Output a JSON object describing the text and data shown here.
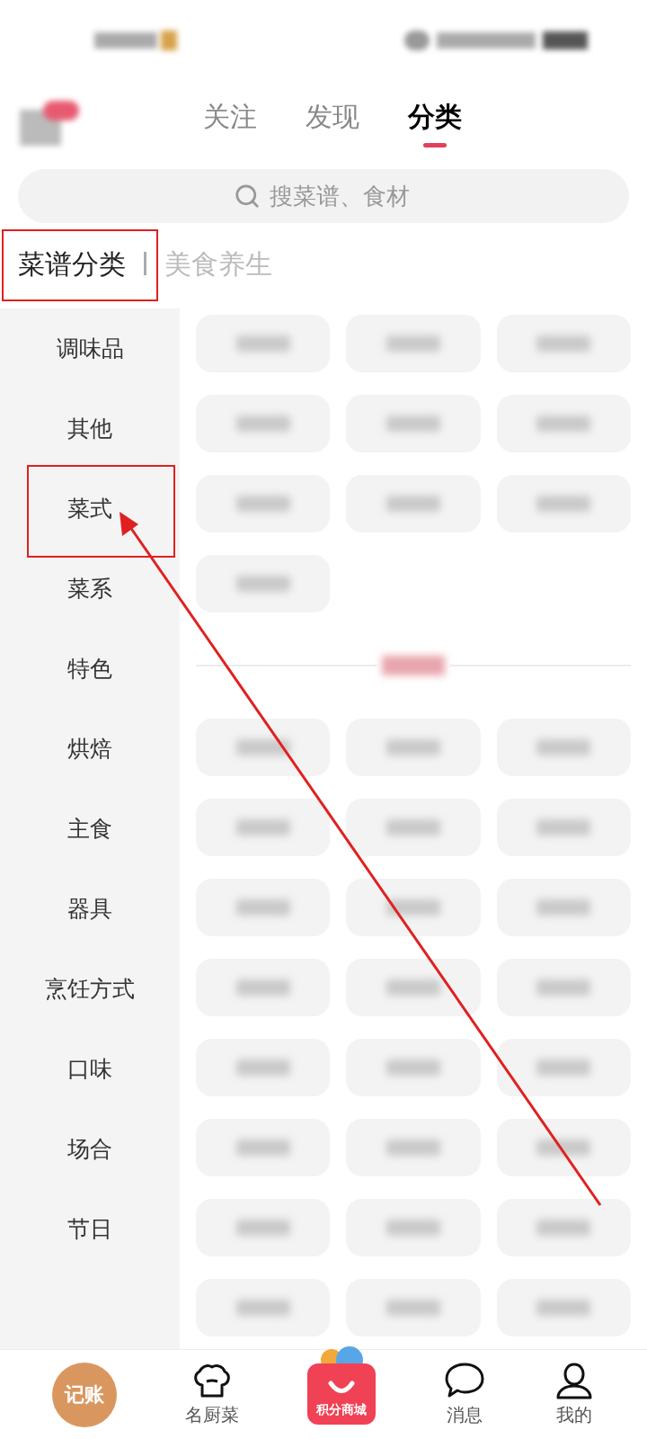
{
  "top_tabs": [
    {
      "label": "关注",
      "selected": false
    },
    {
      "label": "发现",
      "selected": false
    },
    {
      "label": "分类",
      "selected": true
    }
  ],
  "search": {
    "placeholder": "搜菜谱、食材"
  },
  "sub_tabs": [
    {
      "label": "菜谱分类",
      "selected": true
    },
    {
      "label": "美食养生",
      "selected": false
    }
  ],
  "sidebar": {
    "items": [
      "调味品",
      "其他",
      "菜式",
      "菜系",
      "特色",
      "烘焙",
      "主食",
      "器具",
      "烹饪方式",
      "口味",
      "场合",
      "节日"
    ]
  },
  "sections": [
    {
      "kind": "plain",
      "chips": [
        {
          "kind": "blurred"
        },
        {
          "kind": "blurred"
        },
        {
          "kind": "blurred"
        },
        {
          "kind": "blurred"
        },
        {
          "kind": "blurred"
        },
        {
          "kind": "blurred"
        },
        {
          "kind": "blurred"
        },
        {
          "kind": "blurred"
        },
        {
          "kind": "blurred"
        },
        {
          "kind": "blurred"
        }
      ]
    },
    {
      "kind": "titled",
      "chips": [
        {
          "kind": "blurred"
        },
        {
          "kind": "blurred"
        },
        {
          "kind": "blurred"
        },
        {
          "kind": "blurred"
        },
        {
          "kind": "blurred"
        },
        {
          "kind": "blurred"
        },
        {
          "kind": "blurred"
        },
        {
          "kind": "blurred"
        },
        {
          "kind": "blurred"
        },
        {
          "kind": "blurred"
        },
        {
          "kind": "blurred"
        },
        {
          "kind": "blurred"
        },
        {
          "kind": "blurred"
        },
        {
          "kind": "blurred"
        },
        {
          "kind": "blurred"
        },
        {
          "kind": "blurred"
        },
        {
          "kind": "blurred"
        },
        {
          "kind": "blurred"
        },
        {
          "kind": "blurred"
        },
        {
          "kind": "blurred"
        },
        {
          "kind": "blurred"
        },
        {
          "kind": "blurred"
        },
        {
          "kind": "blurred"
        },
        {
          "kind": "blurred"
        }
      ]
    }
  ],
  "bottom_nav": [
    {
      "kind": "badge",
      "label": "记账"
    },
    {
      "kind": "chef",
      "label": "名厨菜"
    },
    {
      "kind": "shop",
      "label": "积分商城"
    },
    {
      "kind": "chat",
      "label": "消息"
    },
    {
      "kind": "user",
      "label": "我的"
    }
  ]
}
